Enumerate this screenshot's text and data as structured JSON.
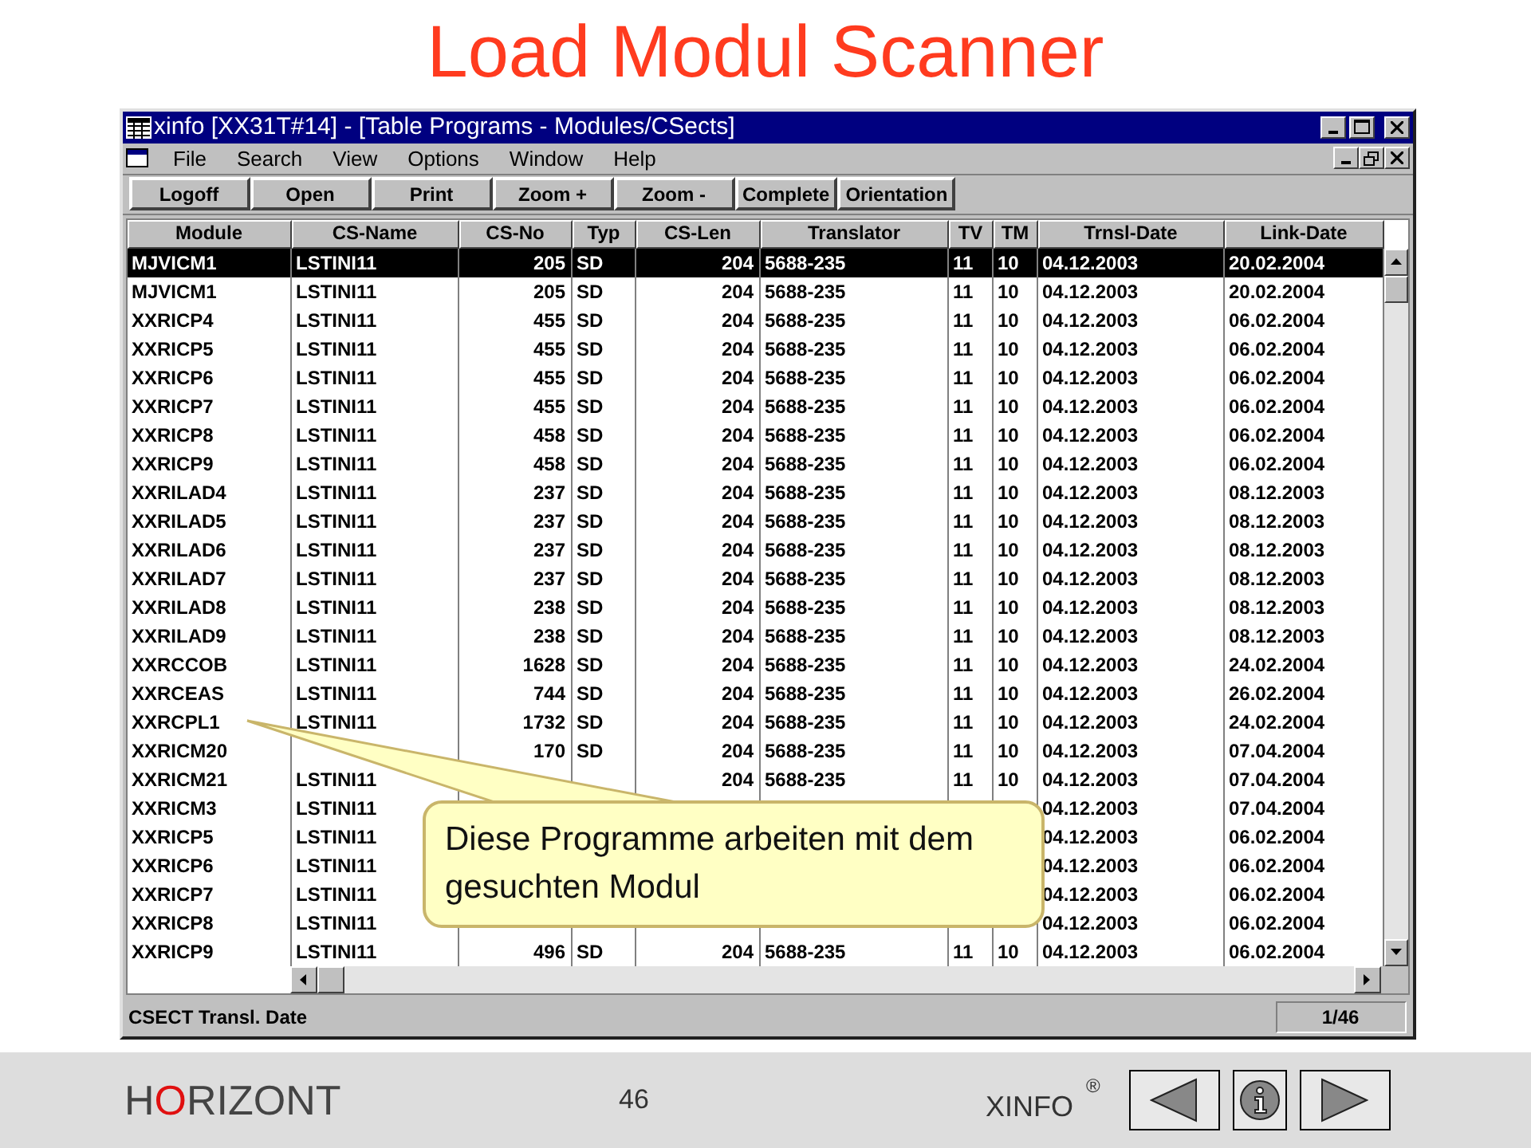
{
  "slide": {
    "title": "Load Modul Scanner"
  },
  "window": {
    "title": "xinfo [XX31T#14] - [Table Programs - Modules/CSects]",
    "menu": [
      "File",
      "Search",
      "View",
      "Options",
      "Window",
      "Help"
    ],
    "toolbar": [
      "Logoff",
      "Open",
      "Print",
      "Zoom +",
      "Zoom -",
      "Complete",
      "Orientation"
    ],
    "table": {
      "columns": [
        "Module",
        "CS-Name",
        "CS-No",
        "Typ",
        "CS-Len",
        "Translator",
        "TV",
        "TM",
        "Trnsl-Date",
        "Link-Date"
      ],
      "rows": [
        {
          "selected": true,
          "cells": [
            "MJVICM1",
            "LSTINI11",
            "205",
            "SD",
            "204",
            "5688-235",
            "11",
            "10",
            "04.12.2003",
            "20.02.2004"
          ]
        },
        {
          "selected": false,
          "cells": [
            "MJVICM1",
            "LSTINI11",
            "205",
            "SD",
            "204",
            "5688-235",
            "11",
            "10",
            "04.12.2003",
            "20.02.2004"
          ]
        },
        {
          "selected": false,
          "cells": [
            "XXRICP4",
            "LSTINI11",
            "455",
            "SD",
            "204",
            "5688-235",
            "11",
            "10",
            "04.12.2003",
            "06.02.2004"
          ]
        },
        {
          "selected": false,
          "cells": [
            "XXRICP5",
            "LSTINI11",
            "455",
            "SD",
            "204",
            "5688-235",
            "11",
            "10",
            "04.12.2003",
            "06.02.2004"
          ]
        },
        {
          "selected": false,
          "cells": [
            "XXRICP6",
            "LSTINI11",
            "455",
            "SD",
            "204",
            "5688-235",
            "11",
            "10",
            "04.12.2003",
            "06.02.2004"
          ]
        },
        {
          "selected": false,
          "cells": [
            "XXRICP7",
            "LSTINI11",
            "455",
            "SD",
            "204",
            "5688-235",
            "11",
            "10",
            "04.12.2003",
            "06.02.2004"
          ]
        },
        {
          "selected": false,
          "cells": [
            "XXRICP8",
            "LSTINI11",
            "458",
            "SD",
            "204",
            "5688-235",
            "11",
            "10",
            "04.12.2003",
            "06.02.2004"
          ]
        },
        {
          "selected": false,
          "cells": [
            "XXRICP9",
            "LSTINI11",
            "458",
            "SD",
            "204",
            "5688-235",
            "11",
            "10",
            "04.12.2003",
            "06.02.2004"
          ]
        },
        {
          "selected": false,
          "cells": [
            "XXRILAD4",
            "LSTINI11",
            "237",
            "SD",
            "204",
            "5688-235",
            "11",
            "10",
            "04.12.2003",
            "08.12.2003"
          ]
        },
        {
          "selected": false,
          "cells": [
            "XXRILAD5",
            "LSTINI11",
            "237",
            "SD",
            "204",
            "5688-235",
            "11",
            "10",
            "04.12.2003",
            "08.12.2003"
          ]
        },
        {
          "selected": false,
          "cells": [
            "XXRILAD6",
            "LSTINI11",
            "237",
            "SD",
            "204",
            "5688-235",
            "11",
            "10",
            "04.12.2003",
            "08.12.2003"
          ]
        },
        {
          "selected": false,
          "cells": [
            "XXRILAD7",
            "LSTINI11",
            "237",
            "SD",
            "204",
            "5688-235",
            "11",
            "10",
            "04.12.2003",
            "08.12.2003"
          ]
        },
        {
          "selected": false,
          "cells": [
            "XXRILAD8",
            "LSTINI11",
            "238",
            "SD",
            "204",
            "5688-235",
            "11",
            "10",
            "04.12.2003",
            "08.12.2003"
          ]
        },
        {
          "selected": false,
          "cells": [
            "XXRILAD9",
            "LSTINI11",
            "238",
            "SD",
            "204",
            "5688-235",
            "11",
            "10",
            "04.12.2003",
            "08.12.2003"
          ]
        },
        {
          "selected": false,
          "cells": [
            "XXRCCOB",
            "LSTINI11",
            "1628",
            "SD",
            "204",
            "5688-235",
            "11",
            "10",
            "04.12.2003",
            "24.02.2004"
          ]
        },
        {
          "selected": false,
          "cells": [
            "XXRCEAS",
            "LSTINI11",
            "744",
            "SD",
            "204",
            "5688-235",
            "11",
            "10",
            "04.12.2003",
            "26.02.2004"
          ]
        },
        {
          "selected": false,
          "cells": [
            "XXRCPL1",
            "LSTINI11",
            "1732",
            "SD",
            "204",
            "5688-235",
            "11",
            "10",
            "04.12.2003",
            "24.02.2004"
          ]
        },
        {
          "selected": false,
          "cells": [
            "XXRICM20",
            null,
            "170",
            "SD",
            "204",
            "5688-235",
            "11",
            "10",
            "04.12.2003",
            "07.04.2004"
          ]
        },
        {
          "selected": false,
          "cells": [
            "XXRICM21",
            "LSTINI11",
            null,
            null,
            "204",
            "5688-235",
            "11",
            "10",
            "04.12.2003",
            "07.04.2004"
          ]
        },
        {
          "selected": false,
          "cells": [
            "XXRICM3",
            "LSTINI11",
            null,
            null,
            null,
            null,
            null,
            null,
            "04.12.2003",
            "07.04.2004"
          ]
        },
        {
          "selected": false,
          "cells": [
            "XXRICP5",
            "LSTINI11",
            null,
            null,
            null,
            null,
            null,
            null,
            "04.12.2003",
            "06.02.2004"
          ]
        },
        {
          "selected": false,
          "cells": [
            "XXRICP6",
            "LSTINI11",
            null,
            null,
            null,
            null,
            null,
            null,
            "04.12.2003",
            "06.02.2004"
          ]
        },
        {
          "selected": false,
          "cells": [
            "XXRICP7",
            "LSTINI11",
            null,
            null,
            null,
            null,
            null,
            null,
            "04.12.2003",
            "06.02.2004"
          ]
        },
        {
          "selected": false,
          "cells": [
            "XXRICP8",
            "LSTINI11",
            null,
            null,
            null,
            null,
            null,
            null,
            "04.12.2003",
            "06.02.2004"
          ]
        },
        {
          "selected": false,
          "cells": [
            "XXRICP9",
            "LSTINI11",
            "496",
            "SD",
            "204",
            "5688-235",
            "11",
            "10",
            "04.12.2003",
            "06.02.2004"
          ]
        }
      ]
    },
    "status_bar": {
      "text": "CSECT Transl. Date",
      "position": "1/46"
    }
  },
  "callout": {
    "text": "Diese Programme arbeiten mit dem gesuchten Modul"
  },
  "footer": {
    "logo": [
      {
        "text": "H",
        "accent": false
      },
      {
        "text": "O",
        "accent": true
      },
      {
        "text": "RIZONT",
        "accent": false
      }
    ],
    "page": "46",
    "product": "XINFO",
    "mark": "®"
  }
}
